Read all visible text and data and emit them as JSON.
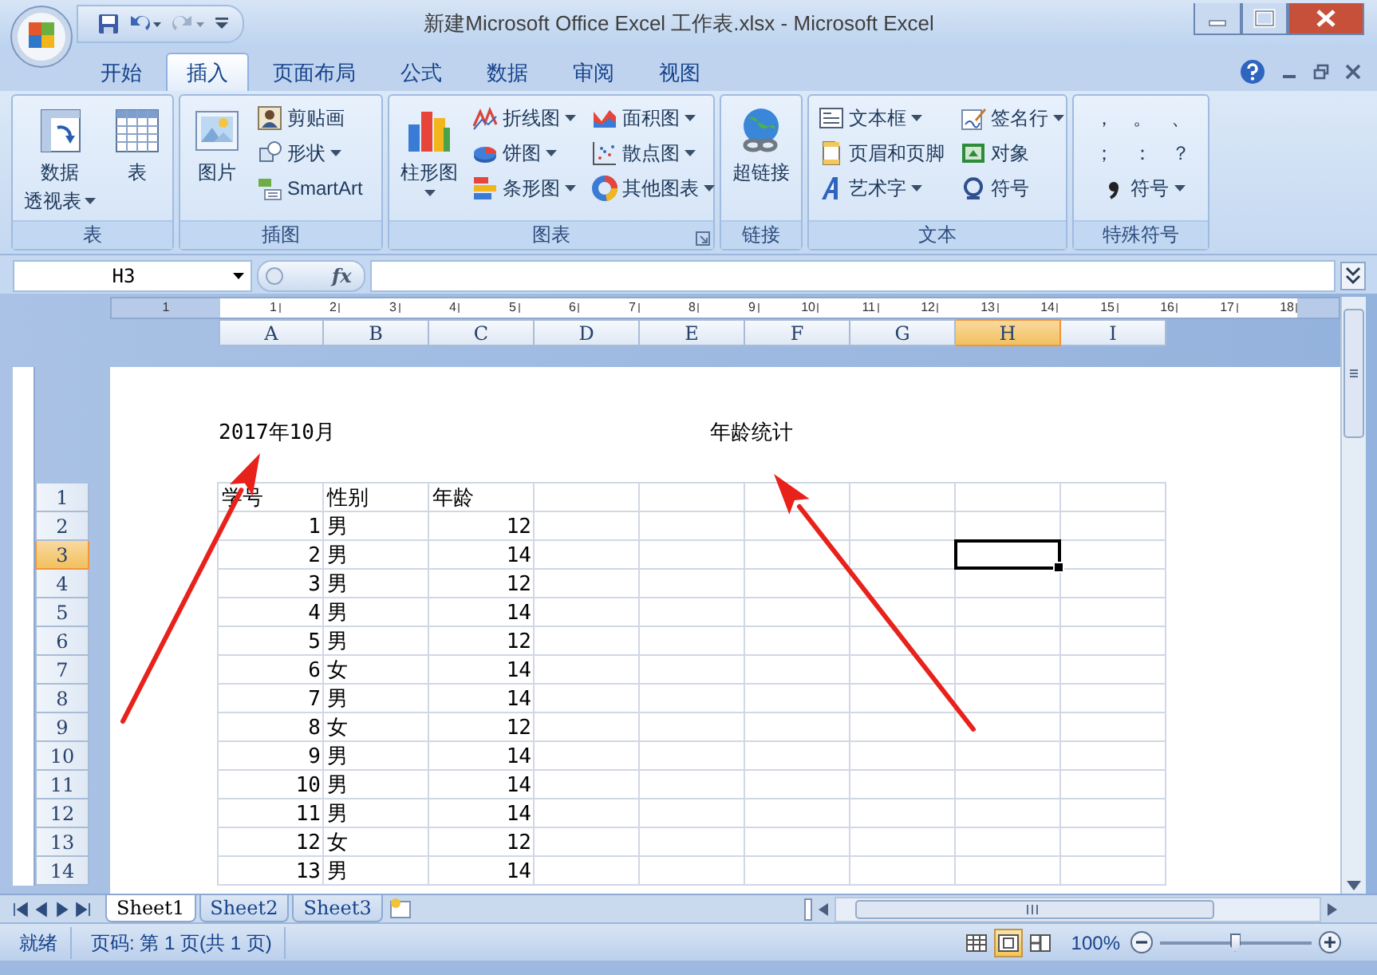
{
  "window": {
    "title": "新建Microsoft Office Excel 工作表.xlsx - Microsoft Excel"
  },
  "ribbon_tabs": [
    {
      "label": "开始",
      "selected": false
    },
    {
      "label": "插入",
      "selected": true
    },
    {
      "label": "页面布局",
      "selected": false
    },
    {
      "label": "公式",
      "selected": false
    },
    {
      "label": "数据",
      "selected": false
    },
    {
      "label": "审阅",
      "selected": false
    },
    {
      "label": "视图",
      "selected": false
    }
  ],
  "ribbon": {
    "groups": [
      {
        "label": "表",
        "launcher": false,
        "items": [
          {
            "kind": "large",
            "lines": [
              "数据",
              "透视表"
            ],
            "dropdown": true
          },
          {
            "kind": "large",
            "lines": [
              "表"
            ],
            "dropdown": false
          }
        ]
      },
      {
        "label": "插图",
        "launcher": false,
        "items": [
          {
            "kind": "large",
            "lines": [
              "图片"
            ],
            "dropdown": false
          },
          {
            "kind": "small",
            "label": "剪贴画",
            "dropdown": false
          },
          {
            "kind": "small",
            "label": "形状",
            "dropdown": true
          },
          {
            "kind": "small",
            "label": "SmartArt",
            "dropdown": false
          }
        ]
      },
      {
        "label": "图表",
        "launcher": true,
        "items": [
          {
            "kind": "large",
            "lines": [
              "柱形图"
            ],
            "dropdown": true
          },
          {
            "kind": "small",
            "label": "折线图",
            "dropdown": true
          },
          {
            "kind": "small",
            "label": "饼图",
            "dropdown": true
          },
          {
            "kind": "small",
            "label": "条形图",
            "dropdown": true
          },
          {
            "kind": "small",
            "label": "面积图",
            "dropdown": true
          },
          {
            "kind": "small",
            "label": "散点图",
            "dropdown": true
          },
          {
            "kind": "small",
            "label": "其他图表",
            "dropdown": true
          }
        ]
      },
      {
        "label": "链接",
        "launcher": false,
        "items": [
          {
            "kind": "large",
            "lines": [
              "超链接"
            ],
            "dropdown": false
          }
        ]
      },
      {
        "label": "文本",
        "launcher": false,
        "items": [
          {
            "kind": "small",
            "label": "文本框",
            "dropdown": true
          },
          {
            "kind": "small",
            "label": "页眉和页脚",
            "dropdown": false
          },
          {
            "kind": "small",
            "label": "艺术字",
            "dropdown": true
          },
          {
            "kind": "small",
            "label": "签名行",
            "dropdown": true
          },
          {
            "kind": "small",
            "label": "对象",
            "dropdown": false
          },
          {
            "kind": "small",
            "label": "符号",
            "dropdown": false
          }
        ]
      },
      {
        "label": "特殊符号",
        "launcher": false,
        "items": [
          {
            "kind": "char",
            "label": "，"
          },
          {
            "kind": "char",
            "label": "。"
          },
          {
            "kind": "char",
            "label": "、"
          },
          {
            "kind": "char",
            "label": "；"
          },
          {
            "kind": "char",
            "label": "："
          },
          {
            "kind": "char",
            "label": "？"
          },
          {
            "kind": "small",
            "label": "符号",
            "dropdown": true
          }
        ]
      }
    ]
  },
  "formula_bar": {
    "name_box": "H3",
    "fx": "fx"
  },
  "sheet": {
    "ruler": [
      "1",
      "1",
      "2",
      "3",
      "4",
      "5",
      "6",
      "7",
      "8",
      "9",
      "10",
      "11",
      "12",
      "13",
      "14",
      "15",
      "16",
      "17",
      "18"
    ],
    "columns": [
      {
        "label": "A",
        "selected": false
      },
      {
        "label": "B",
        "selected": false
      },
      {
        "label": "C",
        "selected": false
      },
      {
        "label": "D",
        "selected": false
      },
      {
        "label": "E",
        "selected": false
      },
      {
        "label": "F",
        "selected": false
      },
      {
        "label": "G",
        "selected": false
      },
      {
        "label": "H",
        "selected": true
      },
      {
        "label": "I",
        "selected": false
      }
    ],
    "header_left": "2017年10月",
    "header_center": "年龄统计",
    "rows": [
      {
        "label": "1",
        "selected": false,
        "kind": "header",
        "cells": [
          "学号",
          "性别",
          "年龄"
        ]
      },
      {
        "label": "2",
        "selected": false,
        "kind": "data",
        "cells": [
          "1",
          "男",
          "12"
        ]
      },
      {
        "label": "3",
        "selected": true,
        "kind": "data",
        "cells": [
          "2",
          "男",
          "14"
        ]
      },
      {
        "label": "4",
        "selected": false,
        "kind": "data",
        "cells": [
          "3",
          "男",
          "12"
        ]
      },
      {
        "label": "5",
        "selected": false,
        "kind": "data",
        "cells": [
          "4",
          "男",
          "14"
        ]
      },
      {
        "label": "6",
        "selected": false,
        "kind": "data",
        "cells": [
          "5",
          "男",
          "12"
        ]
      },
      {
        "label": "7",
        "selected": false,
        "kind": "data",
        "cells": [
          "6",
          "女",
          "14"
        ]
      },
      {
        "label": "8",
        "selected": false,
        "kind": "data",
        "cells": [
          "7",
          "男",
          "14"
        ]
      },
      {
        "label": "9",
        "selected": false,
        "kind": "data",
        "cells": [
          "8",
          "女",
          "12"
        ]
      },
      {
        "label": "10",
        "selected": false,
        "kind": "data",
        "cells": [
          "9",
          "男",
          "14"
        ]
      },
      {
        "label": "11",
        "selected": false,
        "kind": "data",
        "cells": [
          "10",
          "男",
          "14"
        ]
      },
      {
        "label": "12",
        "selected": false,
        "kind": "data",
        "cells": [
          "11",
          "男",
          "14"
        ]
      },
      {
        "label": "13",
        "selected": false,
        "kind": "data",
        "cells": [
          "12",
          "女",
          "12"
        ]
      },
      {
        "label": "14",
        "selected": false,
        "kind": "data",
        "cells": [
          "13",
          "男",
          "14"
        ]
      }
    ]
  },
  "annotations": [
    {
      "kind": "arrow"
    },
    {
      "kind": "arrow"
    }
  ],
  "sheet_tabs": [
    {
      "label": "Sheet1",
      "selected": true
    },
    {
      "label": "Sheet2",
      "selected": false
    },
    {
      "label": "Sheet3",
      "selected": false
    }
  ],
  "status_bar": {
    "mode": "就绪",
    "page": "页码: 第 1 页(共 1 页)",
    "views": [
      {
        "kind": "normal",
        "selected": false
      },
      {
        "kind": "page_layout",
        "selected": true
      },
      {
        "kind": "page_break",
        "selected": false
      }
    ],
    "zoom": {
      "label": "100%",
      "level": 0.5
    }
  }
}
